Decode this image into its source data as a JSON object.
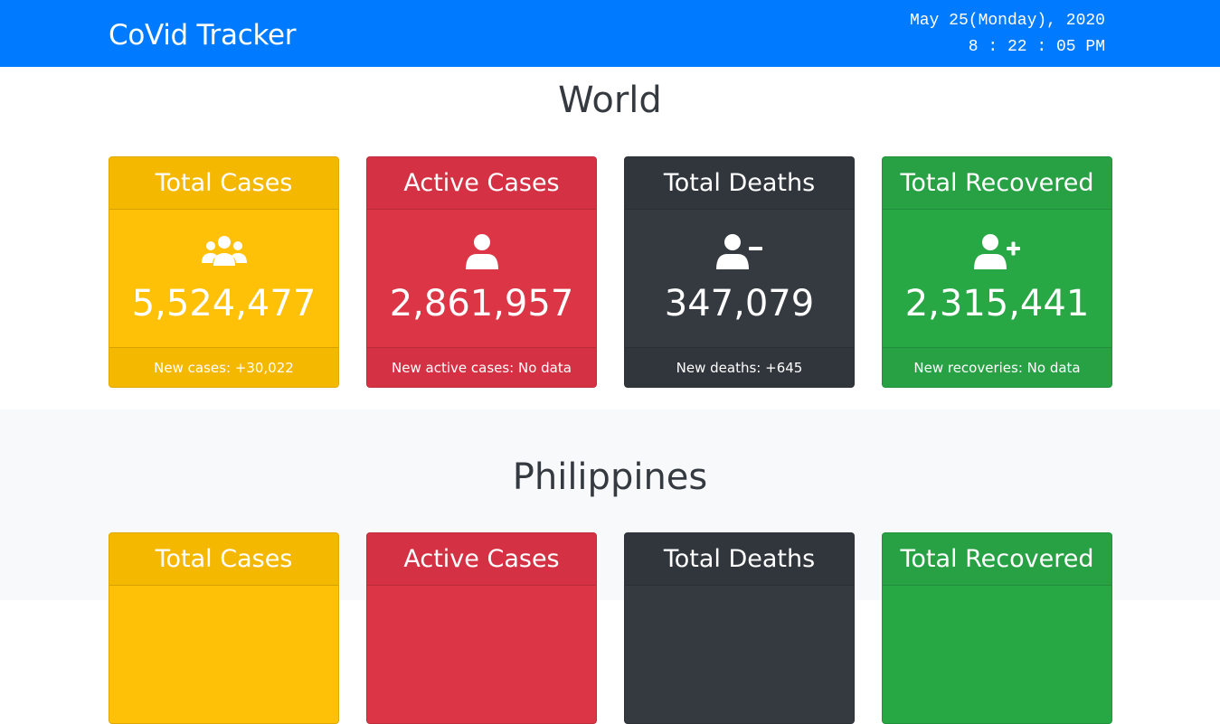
{
  "header": {
    "brand": "CoVid Tracker",
    "date": "May 25(Monday), 2020",
    "time": "8 : 22 : 05 PM"
  },
  "world": {
    "title": "World",
    "cards": [
      {
        "title": "Total Cases",
        "value": "5,524,477",
        "footer": "New cases: +30,022",
        "icon": "users-icon",
        "color": "#ffc107"
      },
      {
        "title": "Active Cases",
        "value": "2,861,957",
        "footer": "New active cases: No data",
        "icon": "user-icon",
        "color": "#dc3545"
      },
      {
        "title": "Total Deaths",
        "value": "347,079",
        "footer": "New deaths: +645",
        "icon": "user-minus-icon",
        "color": "#343a40"
      },
      {
        "title": "Total Recovered",
        "value": "2,315,441",
        "footer": "New recoveries: No data",
        "icon": "user-plus-icon",
        "color": "#28a745"
      }
    ]
  },
  "philippines": {
    "title": "Philippines",
    "cards": [
      {
        "title": "Total Cases"
      },
      {
        "title": "Active Cases"
      },
      {
        "title": "Total Deaths"
      },
      {
        "title": "Total Recovered"
      }
    ]
  }
}
